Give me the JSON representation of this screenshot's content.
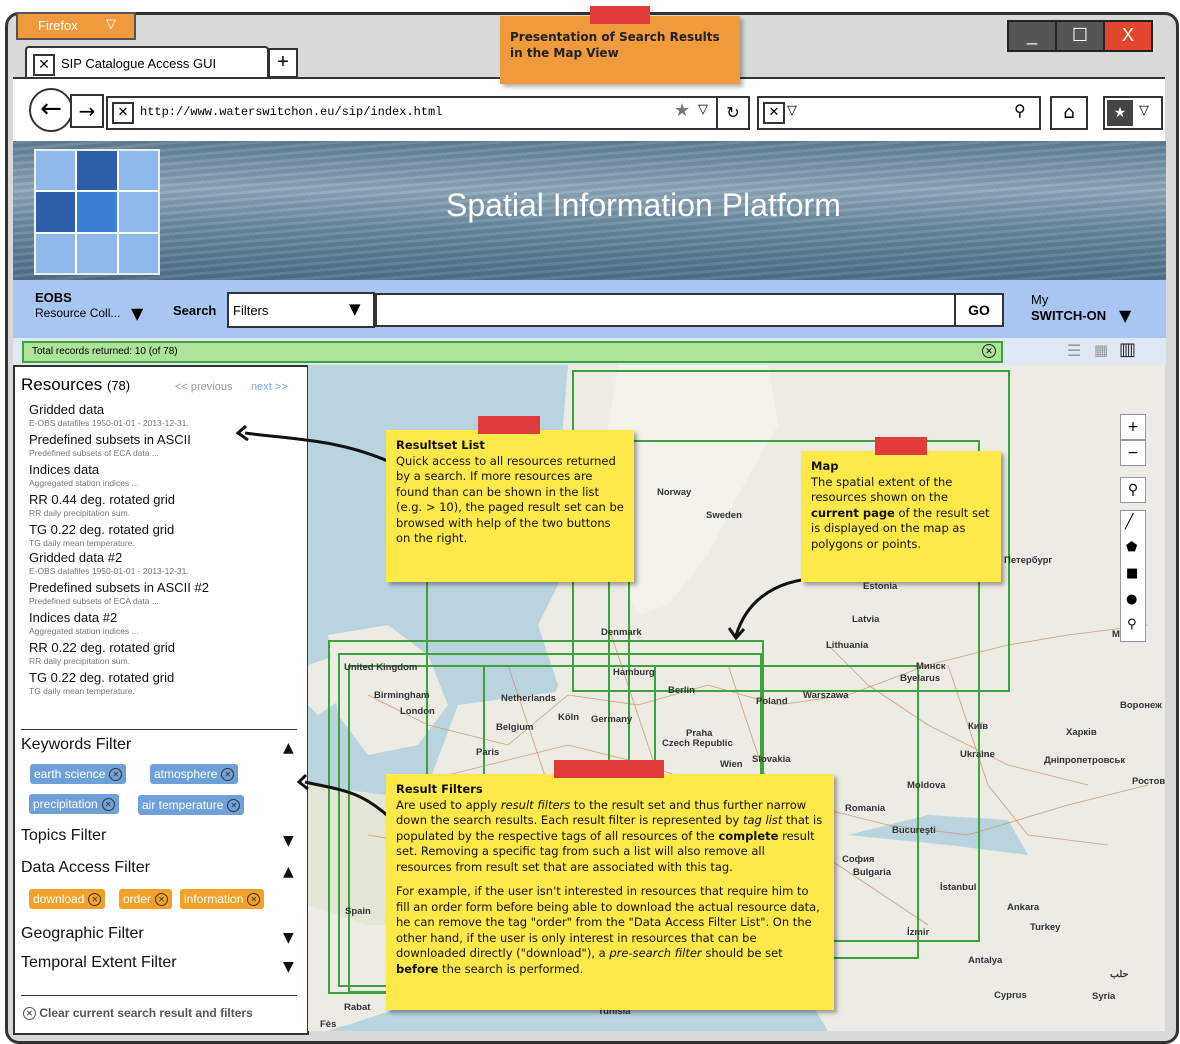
{
  "browser": {
    "firefox_label": "Firefox",
    "tab_title": "SIP Catalogue Access GUI",
    "new_tab": "+",
    "url": "http://www.waterswitchon.eu/sip/index.html",
    "window_minimize": "_",
    "window_maximize": "☐",
    "window_close": "X"
  },
  "header_note": {
    "text": "Presentation of Search Results in the Map View"
  },
  "banner": {
    "title": "Spatial Information Platform"
  },
  "searchbar": {
    "collection_label_top": "EOBS",
    "collection_label": "Resource Coll...",
    "search_label": "Search",
    "filters_label": "Filters",
    "go_label": "GO",
    "my_label_top": "My",
    "my_label": "SWITCH-ON"
  },
  "status": {
    "records_text": "Total records returned: 10 (of 78)"
  },
  "resources": {
    "title": "Resources",
    "count": "(78)",
    "prev": "<< previous",
    "next": "next >>",
    "items": [
      {
        "title": "Gridded data",
        "sub": "E-OBS datafiles 1950-01-01 - 2013-12-31."
      },
      {
        "title": "Predefined subsets in ASCII",
        "sub": "Predefined subsets of ECA data ..."
      },
      {
        "title": "Indices data",
        "sub": "Aggregated station indices ..."
      },
      {
        "title": "RR 0.44 deg. rotated grid",
        "sub": "RR daily precipitation sum."
      },
      {
        "title": "TG 0.22 deg. rotated grid",
        "sub": "TG daily mean temperature."
      },
      {
        "title": "Gridded data #2",
        "sub": "E-OBS datafiles 1950-01-01 - 2013-12-31."
      },
      {
        "title": "Predefined subsets in ASCII #2",
        "sub": "Predefined subsets of ECA data ..."
      },
      {
        "title": "Indices data #2",
        "sub": "Aggregated station indices ..."
      },
      {
        "title": "RR 0.22 deg. rotated grid",
        "sub": "RR daily precipitation sum."
      },
      {
        "title": "TG 0.22 deg. rotated grid",
        "sub": "TG daily mean temperature."
      }
    ]
  },
  "filters": {
    "keywords": {
      "label": "Keywords Filter",
      "tags": [
        "earth science",
        "atmosphere",
        "precipitation",
        "air temperature"
      ]
    },
    "topics": {
      "label": "Topics Filter"
    },
    "data_access": {
      "label": "Data Access Filter",
      "tags": [
        "download",
        "order",
        "information"
      ]
    },
    "geographic": {
      "label": "Geographic Filter"
    },
    "temporal": {
      "label": "Temporal Extent Filter"
    },
    "clear": "Clear current search result and filters"
  },
  "notes": {
    "resultset": {
      "title": "Resultset List",
      "body": "Quick access to all resources returned by a search. If more resources are found than can be shown in the list (e.g. > 10), the paged result set can be browsed with help of the two buttons on the right."
    },
    "map": {
      "title": "Map",
      "body_1": "The spatial extent of the resources shown on the ",
      "body_bold": "current page",
      "body_2": " of the result set is displayed on the map as polygons or points."
    },
    "filters": {
      "title": "Result Filters",
      "p1_a": "Are used to apply ",
      "p1_i1": "result filters",
      "p1_b": " to the result set and thus further narrow down the search results. Each result filter is represented by ",
      "p1_i2": "tag list",
      "p1_c": " that is populated by the respective tags of all resources of the ",
      "p1_bold": "complete",
      "p1_d": " result set. Removing a specific tag from such a list will also remove all resources from result set that are associated with this tag.",
      "p2_a": "For example, if the user isn't interested in resources that require him to fill an order form before being able to download the actual resource data, he can remove the tag \"order\" from the \"Data Access Filter List\". On the other hand, if the user is only interest in resources that can be downloaded directly (\"download\"), a ",
      "p2_i": "pre-search filter",
      "p2_b": " should be set ",
      "p2_bold": "before",
      "p2_c": " the search is performed."
    }
  },
  "map_controls": {
    "zoom_in": "+",
    "zoom_out": "−"
  },
  "map_places": [
    "Norway",
    "Sweden",
    "Estonia",
    "Latvia",
    "Lithuania",
    "Denmark",
    "United Kingdom",
    "Birmingham",
    "London",
    "Netherlands",
    "Hamburg",
    "Berlin",
    "Belgium",
    "Köln",
    "Germany",
    "Poland",
    "Warszawa",
    "Минск",
    "Byelarus",
    "Praha",
    "Czech Republic",
    "Paris",
    "Wien",
    "Slovakia",
    "Київ",
    "Ukraine",
    "Харків",
    "Romania",
    "Moldova",
    "Bucureşti",
    "София",
    "Bulgaria",
    "İstanbul",
    "Ankara",
    "Turkey",
    "Antalya",
    "İzmir",
    "Cyprus",
    "Syria",
    "حلب",
    "Spain",
    "Rabat",
    "Fès",
    "Tunisia",
    "Москв",
    "Ростов",
    "Воронеж",
    "Днiпропетровськ",
    "Петербург"
  ],
  "colors": {
    "accent_blue": "#a9c6f2",
    "status_green": "#aee39b",
    "bbox_green": "#3da13d",
    "note_yellow": "#ffe94a",
    "note_orange": "#f09a3e",
    "tape_red": "#e03c3c",
    "tag_blue": "#6fa0d8",
    "tag_orange": "#f4a12c"
  }
}
